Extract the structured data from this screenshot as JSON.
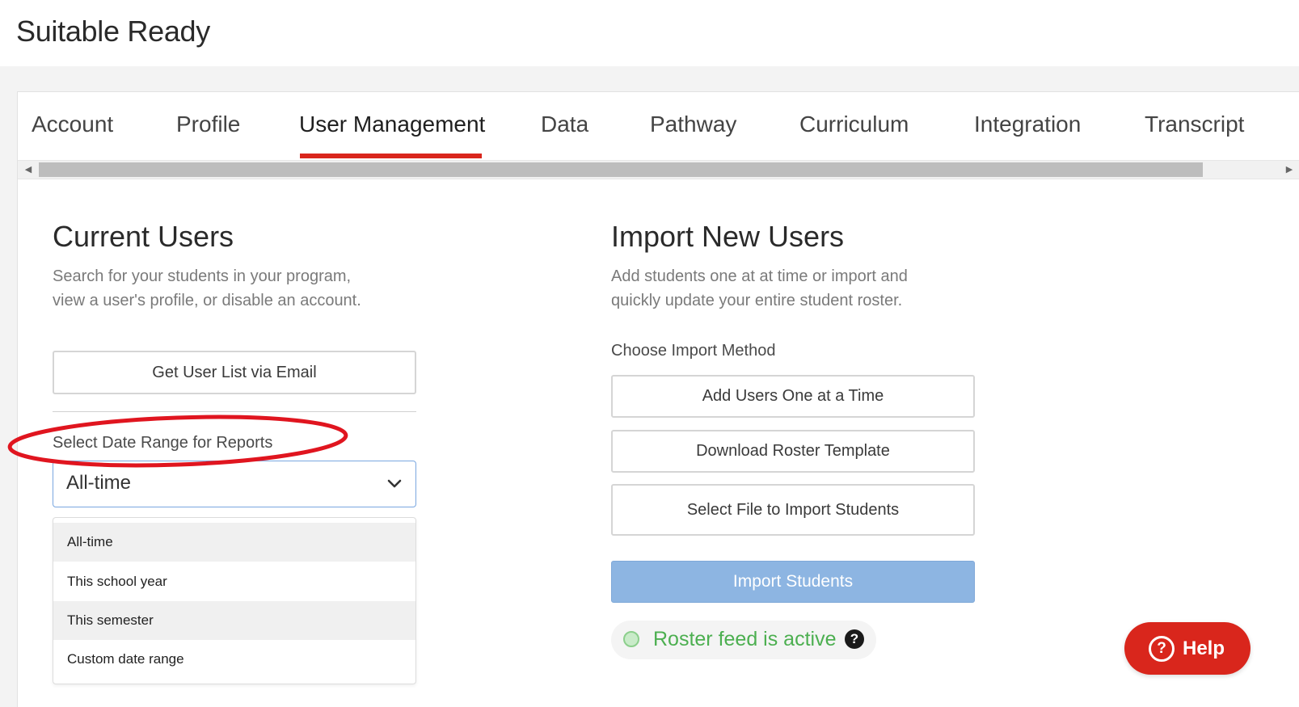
{
  "app": {
    "title": "Suitable Ready"
  },
  "tabs": [
    {
      "label": "Account"
    },
    {
      "label": "Profile"
    },
    {
      "label": "User Management",
      "active": true
    },
    {
      "label": "Data"
    },
    {
      "label": "Pathway"
    },
    {
      "label": "Curriculum"
    },
    {
      "label": "Integration"
    },
    {
      "label": "Transcript"
    }
  ],
  "current_users": {
    "title": "Current Users",
    "desc_line1": "Search for your students in your program,",
    "desc_line2": "view a user's profile, or disable an account.",
    "email_button": "Get User List via Email",
    "date_range_label": "Select Date Range for Reports",
    "date_range_value": "All-time",
    "date_range_options": [
      {
        "label": "All-time",
        "highlighted": true
      },
      {
        "label": "This school year",
        "highlighted": false
      },
      {
        "label": "This semester",
        "highlighted": true
      },
      {
        "label": "Custom date range",
        "highlighted": false
      }
    ]
  },
  "import_users": {
    "title": "Import New Users",
    "desc_line1": "Add students one at at time or import and",
    "desc_line2": "quickly update your entire student roster.",
    "method_label": "Choose Import Method",
    "add_one_button": "Add Users One at a Time",
    "download_template_button": "Download Roster Template",
    "select_file_button": "Select File to Import Students",
    "import_button": "Import Students",
    "roster_status": "Roster feed is active",
    "roster_help_icon": "?"
  },
  "help_button": {
    "label": "Help",
    "icon": "?"
  },
  "colors": {
    "accent_red": "#d9261c",
    "import_blue": "#8db5e2",
    "status_green": "#4caf50",
    "annotation_red": "#e0151f"
  }
}
